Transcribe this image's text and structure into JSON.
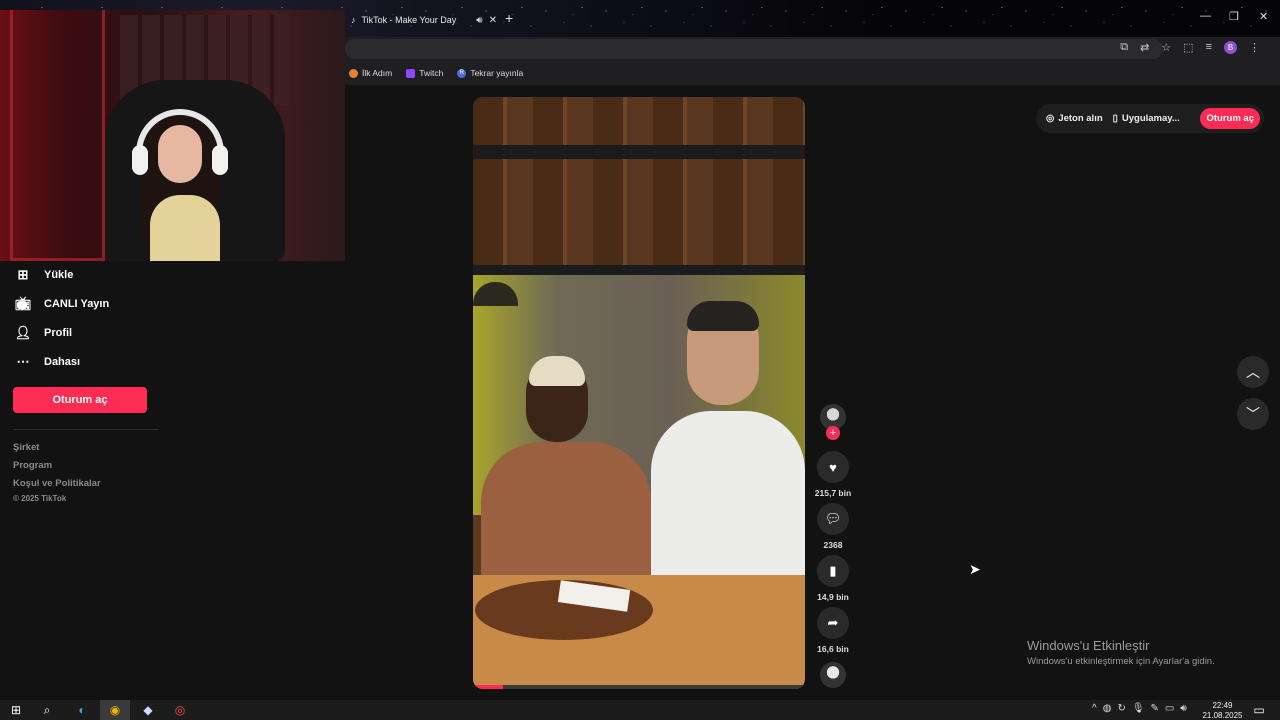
{
  "browser": {
    "tab_title": "TikTok - Make Your Day",
    "bookmarks": [
      {
        "label": "İlk Adım",
        "color": "#e8803a"
      },
      {
        "label": "Twitch",
        "color": "#9146ff"
      },
      {
        "label": "Tekrar yayınla",
        "color": "#4a72d8"
      }
    ],
    "profile_initial": "B"
  },
  "sidebar": {
    "items": [
      {
        "label": "Yükle",
        "icon": "plus-square-icon"
      },
      {
        "label": "CANLI Yayın",
        "icon": "live-tv-icon"
      },
      {
        "label": "Profil",
        "icon": "person-icon"
      },
      {
        "label": "Dahası",
        "icon": "more-dots-icon"
      }
    ],
    "signin_label": "Oturum aç",
    "footer_links": [
      "Şirket",
      "Program",
      "Koşul ve Politikalar"
    ],
    "copyright": "© 2025 TikTok"
  },
  "top_actions": {
    "coins": "Jeton alın",
    "app": "Uygulamay...",
    "signin": "Oturum aç"
  },
  "video": {
    "progress": 0.09,
    "likes": "215,7 bin",
    "comments": "2368",
    "saves": "14,9 bin",
    "shares": "16,6 bin"
  },
  "windows_activation": {
    "title": "Windows'u Etkinleştir",
    "subtitle": "Windows'u etkinleştirmek için Ayarlar'a gidin."
  },
  "clock": {
    "time": "22:49",
    "date": "21.08.2025"
  },
  "colors": {
    "accent": "#fe2c55",
    "background": "#121212"
  }
}
